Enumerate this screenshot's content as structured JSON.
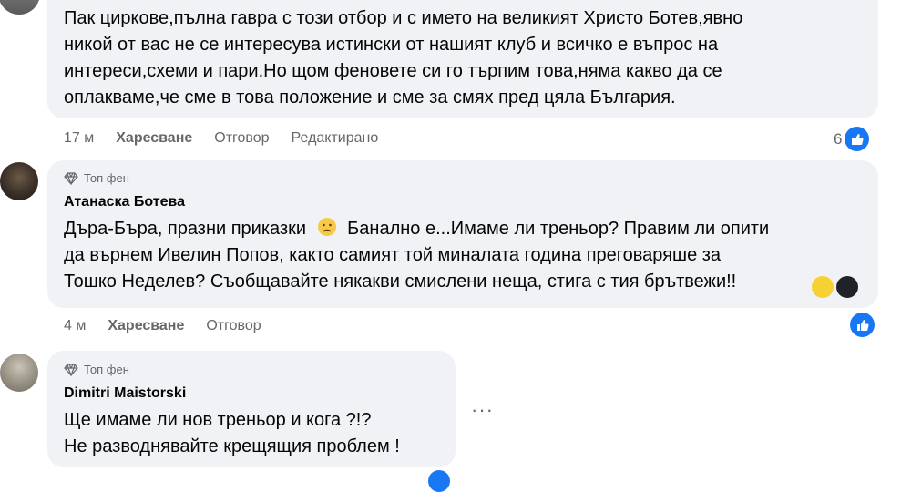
{
  "comment1": {
    "lines": [
      "Пак циркове,пълна гавра с този отбор и с името на великият Христо Ботев,явно",
      "никой от вас не се интересува истински от нашият клуб и всичко е въпрос на",
      "интереси,схеми и пари.Но щом феновете си го търпим това,няма какво да се",
      "оплакваме,че сме в това положение и сме за смях пред цяла България."
    ],
    "time": "17 м",
    "like_label": "Харесване",
    "reply_label": "Отговор",
    "edited_label": "Редактирано",
    "reaction_count": "6"
  },
  "comment2": {
    "badge": "Топ фен",
    "author": "Атанаска Ботева",
    "lines": [
      "Дъра-Бъра, празни приказки",
      "Банално е...Имаме ли треньор? Правим ли опити",
      "да върнем Ивелин Попов, както самият той миналата година преговаряше за",
      "Тошко Неделев? Съобщавайте някакви смислени неща, стига с тия брътвежи!!"
    ],
    "time": "4 м",
    "like_label": "Харесване",
    "reply_label": "Отговор"
  },
  "comment3": {
    "badge": "Топ фен",
    "author": "Dimitri Maistorski",
    "lines": [
      "Ще имаме ли нов треньор и кога ?!?",
      "Не разводнявайте крещящия проблем !"
    ],
    "more_label": "···"
  },
  "icons": {
    "like": "like-reaction-icon",
    "badge": "diamond-icon",
    "emoji": "confused-face-emoji",
    "more": "more-options-icon"
  },
  "colors": {
    "like_blue": "#1877f2",
    "bubble": "#f0f2f5",
    "secondary_text": "#65676b"
  }
}
